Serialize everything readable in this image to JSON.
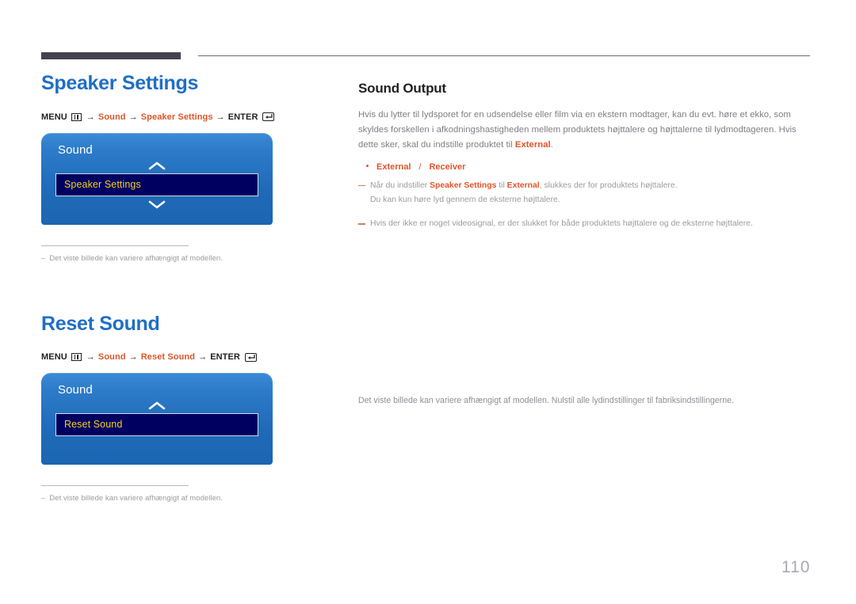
{
  "page": {
    "number": "110"
  },
  "left_column": {
    "sections": [
      {
        "title": "Speaker Settings",
        "menu_path": {
          "menu_label": "MENU",
          "menu_icon": "menu-bars-icon",
          "arrow": "→",
          "step1": "Sound",
          "step2": "Speaker Settings",
          "enter_label": "ENTER",
          "enter_icon": "enter-return-icon"
        },
        "osd": {
          "title": "Sound",
          "up_chevron_icon": "chevron-up-icon",
          "down_chevron_icon": "chevron-down-icon",
          "has_down_chevron": true,
          "selected_row": "Speaker Settings"
        },
        "footnote": {
          "dash": "–",
          "text": "Det viste billede kan variere afhængigt af modellen."
        }
      },
      {
        "title": "Reset Sound",
        "menu_path": {
          "menu_label": "MENU",
          "menu_icon": "menu-bars-icon",
          "arrow": "→",
          "step1": "Sound",
          "step2": "Reset Sound",
          "enter_label": "ENTER",
          "enter_icon": "enter-return-icon"
        },
        "osd": {
          "title": "Sound",
          "up_chevron_icon": "chevron-up-icon",
          "down_chevron_icon": "chevron-down-icon",
          "has_down_chevron": false,
          "selected_row": "Reset Sound"
        },
        "footnote": {
          "dash": "–",
          "text": "Det viste billede kan variere afhængigt af modellen."
        }
      }
    ]
  },
  "right_column": {
    "sound_output": {
      "heading": "Sound Output",
      "paragraph_part1": "Hvis du lytter til lydsporet for en udsendelse eller film via en ekstern modtager, kan du evt. høre et ekko, som skyldes forskellen i afkodningshastigheden mellem produktets højttalere og højttalerne til lydmodtageren. Hvis dette sker, skal du indstille produktet til ",
      "paragraph_highlight": "External",
      "paragraph_part2": ".",
      "bullet": {
        "option1": "External",
        "separator": "/",
        "option2": "Receiver"
      },
      "note1_part1": "Når du indstiller ",
      "note1_highlight1": "Speaker Settings",
      "note1_part2": " til ",
      "note1_highlight2": "External",
      "note1_part3": ", slukkes der for produktets højttalere.",
      "note1_sub": "Du kan kun høre lyd gennem de eksterne højttalere.",
      "note2": "Hvis der ikke er noget videosignal, er der slukket for både produktets højttalere og de eksterne højttalere."
    },
    "reset_sound": {
      "paragraph": "Det viste billede kan variere afhængigt af modellen. Nulstil alle lydindstillinger til fabriksindstillingerne."
    }
  },
  "colors": {
    "heading_blue": "#1f6fc4",
    "accent_orange": "#e0542a",
    "osd_blue_top": "#3b8ad6",
    "osd_blue_bottom": "#1c65b2",
    "osd_row_navy": "#000060",
    "osd_row_text": "#f5d020",
    "body_gray": "#7f7f86",
    "rule_dark": "#45414f"
  }
}
